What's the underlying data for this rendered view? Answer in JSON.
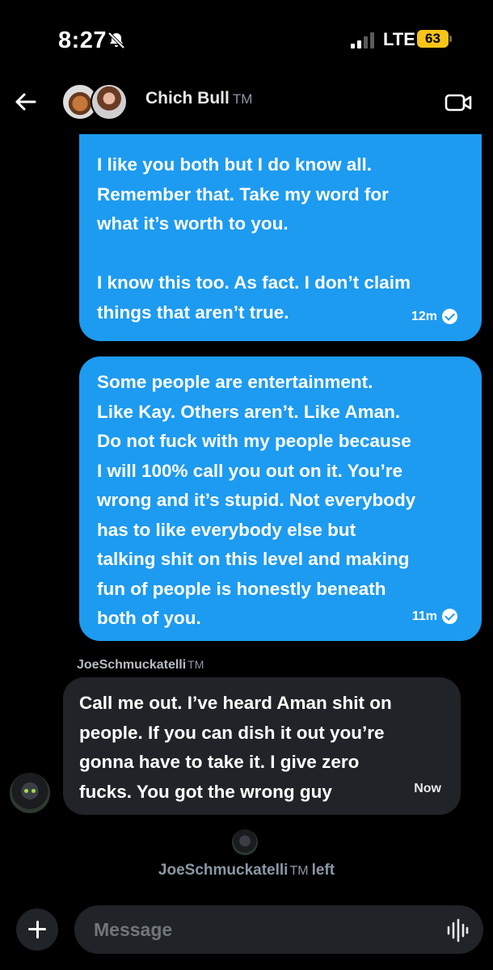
{
  "status": {
    "time": "8:27",
    "network": "LTE",
    "battery": "63"
  },
  "header": {
    "title": "Chich Bull",
    "title_badge": "TM"
  },
  "messages": [
    {
      "direction": "out",
      "text": "I like you both but I do know all.\nRemember that. Take my word for\nwhat it’s worth to you.\n\nI know this too. As fact. I don’t claim\nthings that aren’t true.",
      "time": "12m"
    },
    {
      "direction": "out",
      "text": "Some people are entertainment.\nLike Kay. Others aren’t. Like Aman.\nDo not fuck with my people because\nI will 100% call you out on it. You’re\nwrong and it’s stupid. Not everybody\nhas to like everybody else but\ntalking shit on this level and making\nfun of people is honestly beneath\nboth of you.",
      "time": "11m"
    },
    {
      "direction": "in",
      "sender": "JoeSchmuckatelli",
      "sender_badge": "TM",
      "text": "Call me out. I’ve heard Aman shit on\npeople. If you can dish it out you’re\ngonna have to take it.  I give zero\nfucks.  You got the wrong guy",
      "time": "Now"
    }
  ],
  "system_event": {
    "user": "JoeSchmuckatelli",
    "badge": "TM",
    "action": "left"
  },
  "composer": {
    "placeholder": "Message"
  },
  "colors": {
    "background": "#000000",
    "outgoing_bubble": "#1d9bf0",
    "incoming_bubble": "#202327",
    "battery": "#f5c518"
  },
  "icons": [
    "bell-slash-icon",
    "signal-icon",
    "battery-icon",
    "back-arrow-icon",
    "video-call-icon",
    "plus-icon",
    "voice-wave-icon",
    "check-circle-icon"
  ]
}
